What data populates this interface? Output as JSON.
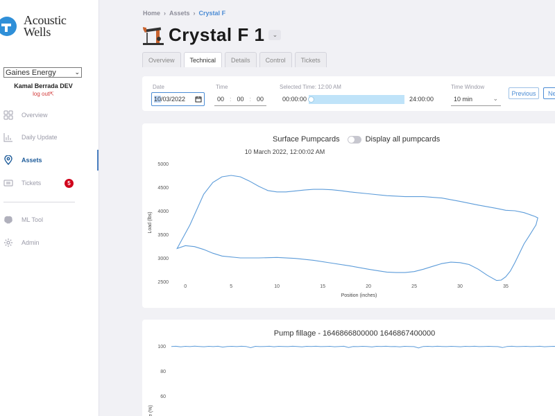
{
  "sidebar": {
    "brand_line1": "Acoustic",
    "brand_line2": "Wells",
    "org_selected": "Gaines Energy",
    "user_name": "Kamal Berrada DEV",
    "logout_label": "log out",
    "nav": [
      {
        "label": "Overview",
        "icon": "grid-icon"
      },
      {
        "label": "Daily Update",
        "icon": "bar-chart-icon"
      },
      {
        "label": "Assets",
        "icon": "map-pin-icon"
      },
      {
        "label": "Tickets",
        "icon": "ticket-icon",
        "badge": "5"
      },
      {
        "label": "ML Tool",
        "icon": "brain-icon"
      },
      {
        "label": "Admin",
        "icon": "gear-icon"
      }
    ]
  },
  "breadcrumb": {
    "home": "Home",
    "sep": "›",
    "assets": "Assets",
    "current": "Crystal F"
  },
  "page_title": "Crystal F 1",
  "tabs": [
    "Overview",
    "Technical",
    "Details",
    "Control",
    "Tickets"
  ],
  "active_tab": "Technical",
  "controls": {
    "date_label": "Date",
    "date_highlight": "10",
    "date_rest": "/03/2022",
    "time_label": "Time",
    "time_hh": "00",
    "time_mm": "00",
    "time_ss": "00",
    "time_sep": ":",
    "selected_time_label": "Selected Time: 12:00 AM",
    "slider_start": "00:00:00",
    "slider_end": "24:00:00",
    "window_label": "Time Window",
    "window_value": "10 min",
    "prev_label": "Previous",
    "next_label": "Next"
  },
  "pumpcard": {
    "title": "Surface Pumpcards",
    "toggle_label": "Display all pumpcards",
    "timestamp": "10 March 2022, 12:00:02 AM"
  },
  "fillage": {
    "title": "Pump fillage - 1646866800000 1646867400000"
  },
  "colors": {
    "accent": "#4a8bd4",
    "line": "#5b9bd9",
    "badge": "#d0021b"
  },
  "chart_data": [
    {
      "type": "line",
      "title": "",
      "xlabel": "Position (inches)",
      "ylabel": "Load (lbs)",
      "xlim": [
        -1,
        40
      ],
      "ylim": [
        2500,
        5000
      ],
      "x_ticks": [
        0,
        5,
        10,
        15,
        20,
        25,
        30,
        35
      ],
      "y_ticks": [
        2500,
        3000,
        3500,
        4000,
        4500,
        5000
      ],
      "grid": false,
      "series": [
        {
          "closed": true,
          "x": [
            -0.9,
            0.5,
            2,
            3,
            4,
            5,
            6,
            7,
            8,
            9,
            10,
            11,
            12,
            13,
            14,
            15,
            16,
            17,
            18,
            20,
            22,
            24,
            26,
            28,
            30,
            32,
            34,
            35,
            36,
            37,
            38.2,
            38.5,
            38.3,
            37.5,
            37,
            36.5,
            36,
            35.5,
            35,
            34.5,
            34,
            33,
            32,
            31,
            30,
            29,
            28,
            27,
            26,
            25,
            24,
            23,
            22,
            21,
            20,
            18,
            16,
            14,
            12,
            10,
            8,
            6,
            4,
            3,
            2,
            1,
            0,
            -0.9
          ],
          "y": [
            3200,
            3700,
            4350,
            4600,
            4720,
            4750,
            4720,
            4630,
            4520,
            4430,
            4400,
            4400,
            4420,
            4440,
            4455,
            4455,
            4445,
            4425,
            4400,
            4360,
            4320,
            4300,
            4300,
            4270,
            4200,
            4120,
            4050,
            4010,
            4000,
            3960,
            3880,
            3850,
            3700,
            3450,
            3300,
            3100,
            2900,
            2720,
            2600,
            2530,
            2520,
            2630,
            2760,
            2860,
            2900,
            2910,
            2880,
            2820,
            2760,
            2710,
            2690,
            2690,
            2700,
            2730,
            2760,
            2830,
            2890,
            2950,
            2990,
            3010,
            3000,
            3000,
            3040,
            3100,
            3180,
            3240,
            3260,
            3200
          ]
        }
      ]
    },
    {
      "type": "line",
      "title": "Pump fillage - 1646866800000 1646867400000",
      "ylabel": "Fillage (%)",
      "y_ticks": [
        60,
        80,
        100
      ],
      "ylim": [
        50,
        105
      ],
      "grid": false,
      "series": [
        {
          "values": [
            99.6,
            99.8,
            99.3,
            99.7,
            99.5,
            99.9,
            99.6,
            99.4,
            99.7,
            99.5,
            99.8,
            99.1,
            99.6,
            99.7,
            99.5,
            99.8,
            99.6,
            98.6,
            99.7,
            99.5,
            99.6,
            99.8,
            99.4,
            99.7,
            99.6,
            99.5,
            99.8,
            99.6,
            99.3,
            99.7,
            99.6,
            99.8,
            99.5,
            99.6,
            99.7,
            99.4,
            99.6,
            99.8,
            98.8,
            99.6,
            99.5,
            99.7,
            99.6,
            99.2,
            99.7,
            99.6,
            99.8,
            99.5,
            99.6,
            99.3,
            99.7,
            99.6,
            99.5,
            98.4,
            99.6,
            99.7,
            99.5,
            99.8,
            99.6,
            99.5,
            99.7,
            99.6,
            99.4,
            99.7,
            99.6,
            99.8,
            99.5,
            99.6,
            99.7,
            99.6,
            99.5,
            98.7,
            99.6,
            99.8,
            99.5,
            99.6,
            99.7,
            99.5,
            99.6,
            99.8,
            99.4,
            99.6,
            99.7,
            99.5
          ]
        }
      ]
    }
  ]
}
